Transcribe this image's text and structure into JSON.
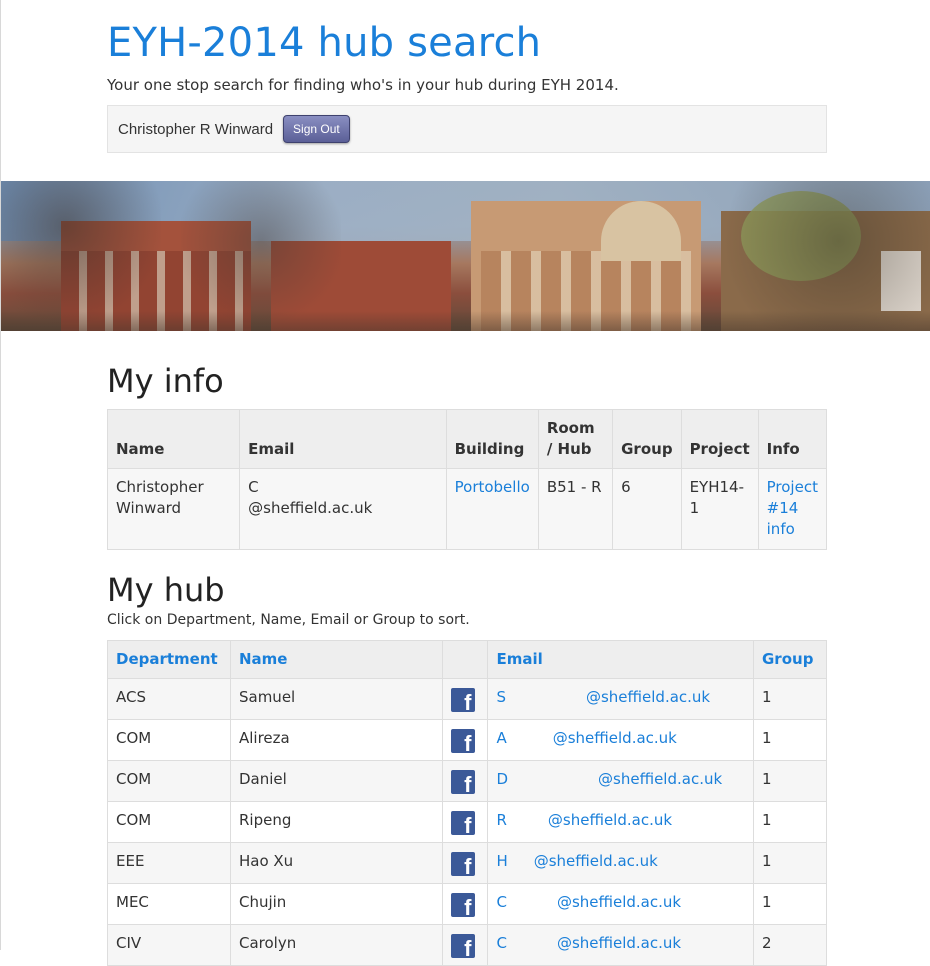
{
  "header": {
    "title": "EYH-2014 hub search",
    "subtitle": "Your one stop search for finding who's in your hub during EYH 2014.",
    "user_name": "Christopher R Winward",
    "sign_out_label": "Sign Out"
  },
  "my_info": {
    "heading": "My info",
    "columns": [
      "Name",
      "Email",
      "Building",
      "Room / Hub",
      "Group",
      "Project",
      "Info"
    ],
    "row": {
      "name": "Christopher Winward",
      "email_prefix": "C",
      "email_domain": "@sheffield.ac.uk",
      "building": "Portobello",
      "room_hub": "B51 - R",
      "group": "6",
      "project": "EYH14-1",
      "info_link": "Project #14 info"
    }
  },
  "my_hub": {
    "heading": "My hub",
    "hint": "Click on Department, Name, Email or Group to sort.",
    "columns": [
      "Department",
      "Name",
      "",
      "Email",
      "Group"
    ],
    "rows": [
      {
        "department": "ACS",
        "name": "Samuel",
        "email_prefix": "S",
        "email_domain": "@sheffield.ac.uk",
        "group": "1",
        "gap": 80
      },
      {
        "department": "COM",
        "name": "Alireza",
        "email_prefix": "A",
        "email_domain": "@sheffield.ac.uk",
        "group": "1",
        "gap": 46
      },
      {
        "department": "COM",
        "name": "Daniel",
        "email_prefix": "D",
        "email_domain": "@sheffield.ac.uk",
        "group": "1",
        "gap": 90
      },
      {
        "department": "COM",
        "name": "Ripeng",
        "email_prefix": "R",
        "email_domain": "@sheffield.ac.uk",
        "group": "1",
        "gap": 41
      },
      {
        "department": "EEE",
        "name": "Hao Xu",
        "email_prefix": "H",
        "email_domain": "@sheffield.ac.uk",
        "group": "1",
        "gap": 26
      },
      {
        "department": "MEC",
        "name": "Chujin",
        "email_prefix": "C",
        "email_domain": "@sheffield.ac.uk",
        "group": "1",
        "gap": 50
      },
      {
        "department": "CIV",
        "name": "Carolyn",
        "email_prefix": "C",
        "email_domain": "@sheffield.ac.uk",
        "group": "2",
        "gap": 50
      }
    ]
  },
  "icons": {
    "facebook": "facebook-icon"
  },
  "colors": {
    "link": "#1a7fd9",
    "button": "#5b5f97",
    "facebook": "#3b5998"
  }
}
